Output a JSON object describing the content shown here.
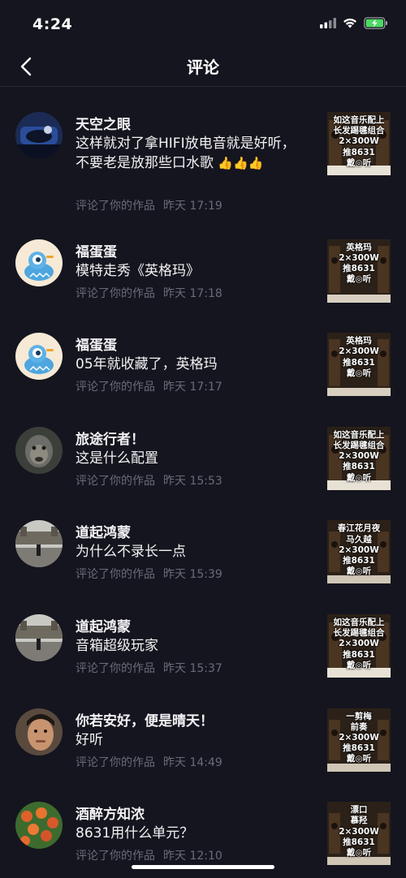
{
  "status": {
    "time": "4:24"
  },
  "nav": {
    "title": "评论"
  },
  "comments": [
    {
      "user": "天空之眼",
      "text": "这样就对了拿HIFI放电音就是好听，不要老是放那些口水歌",
      "action": "评论了你的作品",
      "time": "昨天 17:19",
      "thumb": "如这音乐配上\n长发踢毽组合\n2×300W\n推8631\n戴◎听",
      "emoji": "👍👍👍"
    },
    {
      "user": "福蛋蛋",
      "text": "模特走秀《英格玛》",
      "action": "评论了你的作品",
      "time": "昨天 17:18",
      "thumb": "英格玛\n2×300W\n推8631\n戴◎听"
    },
    {
      "user": "福蛋蛋",
      "text": "05年就收藏了，英格玛",
      "action": "评论了你的作品",
      "time": "昨天 17:17",
      "thumb": "英格玛\n2×300W\n推8631\n戴◎听"
    },
    {
      "user": "旅途行者！",
      "text": "这是什么配置",
      "action": "评论了你的作品",
      "time": "昨天 15:53",
      "thumb": "如这音乐配上\n长发踢毽组合\n2×300W\n推8631\n戴◎听"
    },
    {
      "user": "道起鸿蒙",
      "text": "为什么不录长一点",
      "action": "评论了你的作品",
      "time": "昨天 15:39",
      "thumb": "春江花月夜\n马久越\n2×300W\n推8631\n戴◎听"
    },
    {
      "user": "道起鸿蒙",
      "text": "音箱超级玩家",
      "action": "评论了你的作品",
      "time": "昨天 15:37",
      "thumb": "如这音乐配上\n长发踢毽组合\n2×300W\n推8631\n戴◎听"
    },
    {
      "user": "你若安好，便是晴天！",
      "text": "好听",
      "action": "评论了你的作品",
      "time": "昨天 14:49",
      "thumb": "一剪梅\n前奏\n2×300W\n推8631\n戴◎听"
    },
    {
      "user": "酒醉方知浓",
      "text": "8631用什么单元？",
      "action": "评论了你的作品",
      "time": "昨天 12:10",
      "thumb": "漂口\n慕羟\n2×300W\n推8631\n戴◎听"
    }
  ]
}
